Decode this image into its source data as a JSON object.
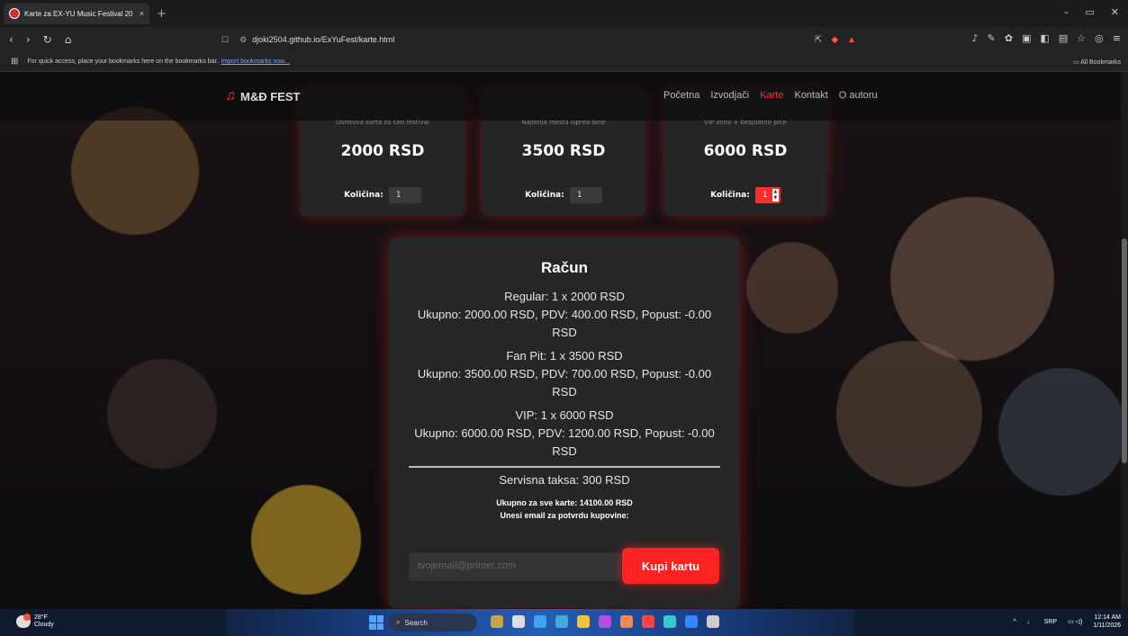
{
  "browser": {
    "tab_title": "Karte za EX-YU Music Festival 20",
    "tab_close": "×",
    "new_tab": "+",
    "url": "djoki2504.github.io/ExYuFest/karte.html",
    "bookmarks_text": "For quick access, place your bookmarks here on the bookmarks bar.",
    "bookmarks_link": "Import bookmarks now...",
    "all_bookmarks": "All Bookmarks"
  },
  "site": {
    "logo": "M&Đ FEST",
    "menu": [
      "Početna",
      "Izvodjači",
      "Karte",
      "Kontakt",
      "O autoru"
    ],
    "active_menu": "Karte"
  },
  "tickets": [
    {
      "feature": "Osnovna karta za ceo festival",
      "price": "2000 RSD",
      "qty_label": "Količina:",
      "qty": "1"
    },
    {
      "feature": "Najbolja mesta ispred bine",
      "price": "3500 RSD",
      "qty_label": "Količina:",
      "qty": "1"
    },
    {
      "feature": "VIP zona + besplatno piće",
      "price": "6000 RSD",
      "qty_label": "Količina:",
      "qty": "1"
    }
  ],
  "bill": {
    "title": "Račun",
    "items": [
      {
        "line1": "Regular: 1 x 2000 RSD",
        "line2": "Ukupno: 2000.00 RSD, PDV: 400.00 RSD, Popust: -0.00 RSD"
      },
      {
        "line1": "Fan Pit: 1 x 3500 RSD",
        "line2": "Ukupno: 3500.00 RSD, PDV: 700.00 RSD, Popust: -0.00 RSD"
      },
      {
        "line1": "VIP: 1 x 6000 RSD",
        "line2": "Ukupno: 6000.00 RSD, PDV: 1200.00 RSD, Popust: -0.00 RSD"
      }
    ],
    "service": "Servisna taksa: 300 RSD",
    "total": "Ukupno za sve karte: 14100.00 RSD",
    "email_prompt": "Unesi email za potvrdu kupovine:",
    "email_placeholder": "tvojemail@primer.com",
    "buy_label": "Kupi kartu"
  },
  "taskbar": {
    "temp": "28°F",
    "weather": "Cloudy",
    "search": "Search",
    "lang": "SRP",
    "time": "12:14 AM",
    "date": "1/11/2026"
  },
  "colors": {
    "accent": "#ff2222"
  }
}
